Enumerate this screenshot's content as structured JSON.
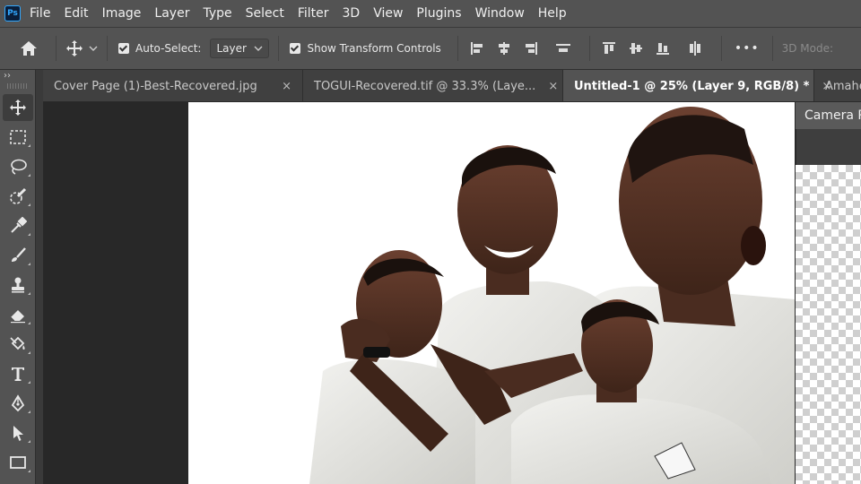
{
  "app": {
    "logo_text": "Ps"
  },
  "menu": [
    "File",
    "Edit",
    "Image",
    "Layer",
    "Type",
    "Select",
    "Filter",
    "3D",
    "View",
    "Plugins",
    "Window",
    "Help"
  ],
  "options": {
    "auto_select_label": "Auto-Select:",
    "auto_select_checked": true,
    "auto_select_target": "Layer",
    "show_transform_label": "Show Transform Controls",
    "show_transform_checked": true,
    "more_label": "•••",
    "mode_label": "3D Mode:"
  },
  "toolbar": {
    "collapse_label": "››",
    "tools": [
      "move-tool",
      "marquee-tool",
      "lasso-tool",
      "quick-selection-tool",
      "eyedropper-tool",
      "brush-tool",
      "clone-stamp-tool",
      "eraser-tool",
      "paint-bucket-tool",
      "type-tool",
      "pen-tool",
      "path-selection-tool",
      "rectangle-tool"
    ]
  },
  "tabs": [
    {
      "title": "Cover Page (1)-Best-Recovered.jpg",
      "active": false
    },
    {
      "title": "TOGUI-Recovered.tif @ 33.3% (Laye...",
      "active": false
    },
    {
      "title": "Untitled-1 @ 25% (Layer 9, RGB/8) *",
      "active": true
    },
    {
      "title": "Amahe",
      "active": false
    }
  ],
  "tab_close_glyph": "×",
  "panel": {
    "title": "Camera R"
  },
  "colors": {
    "ui": "#535353",
    "workspace": "#282828",
    "accent": "#31a8ff",
    "canvas": "#ffffff"
  }
}
